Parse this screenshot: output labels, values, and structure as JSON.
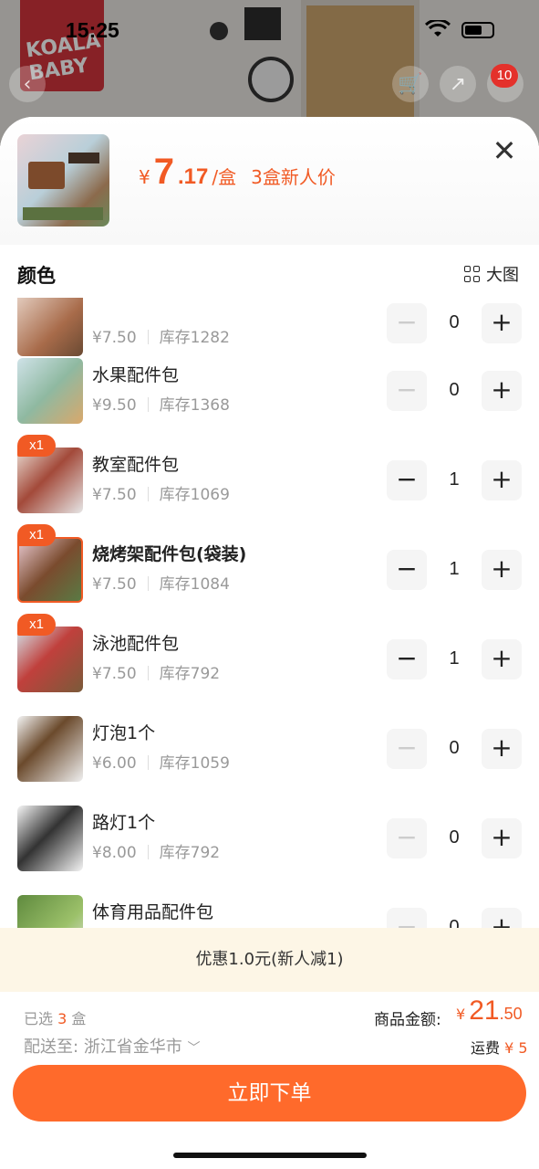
{
  "status_bar": {
    "time": "15:25"
  },
  "background": {
    "logo_text": "KOALA BABY",
    "cart_count": "10"
  },
  "sheet": {
    "price_currency": "¥",
    "price_int": "7",
    "price_dec": ".17",
    "price_unit": "/盒",
    "promo_text": "3盒新人价"
  },
  "section": {
    "title": "颜色",
    "big_image_label": "大图"
  },
  "items": [
    {
      "name": "",
      "price": "¥7.50",
      "stock": "库存1282",
      "qty": "0",
      "selected": false
    },
    {
      "name": "水果配件包",
      "price": "¥9.50",
      "stock": "库存1368",
      "qty": "0",
      "selected": false
    },
    {
      "name": "教室配件包",
      "price": "¥7.50",
      "stock": "库存1069",
      "qty": "1",
      "badge": "x1",
      "selected": false
    },
    {
      "name": "烧烤架配件包(袋装)",
      "price": "¥7.50",
      "stock": "库存1084",
      "qty": "1",
      "badge": "x1",
      "selected": true
    },
    {
      "name": "泳池配件包",
      "price": "¥7.50",
      "stock": "库存792",
      "qty": "1",
      "badge": "x1",
      "selected": false
    },
    {
      "name": "灯泡1个",
      "price": "¥6.00",
      "stock": "库存1059",
      "qty": "0",
      "selected": false
    },
    {
      "name": "路灯1个",
      "price": "¥8.00",
      "stock": "库存792",
      "qty": "0",
      "selected": false
    },
    {
      "name": "体育用品配件包",
      "price": "",
      "stock": "",
      "qty": "0",
      "selected": false
    }
  ],
  "discount_text": "优惠1.0元(新人减1)",
  "footer": {
    "selected_prefix": "已选",
    "selected_count": "3",
    "selected_suffix": "盒",
    "ship_label": "配送至:",
    "ship_location": "浙江省金华市",
    "total_label": "商品金额:",
    "total_currency": "¥",
    "total_int": "21",
    "total_dec": ".50",
    "freight_label": "运费",
    "freight_value": "¥ 5",
    "order_button": "立即下单"
  },
  "colors": {
    "accent": "#f15a24",
    "button": "#ff6a2b",
    "discount_bg": "#fdf6e6"
  }
}
